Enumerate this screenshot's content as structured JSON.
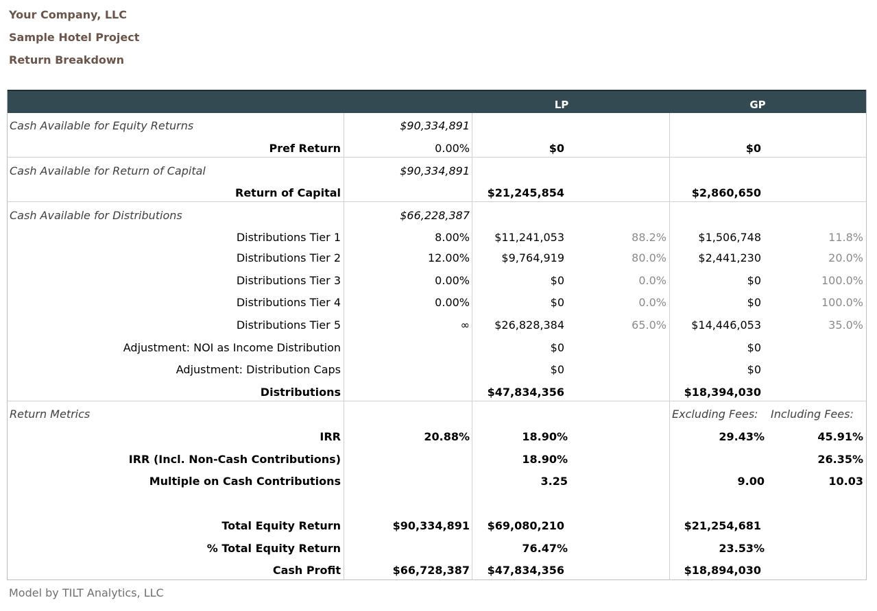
{
  "header": {
    "company": "Your Company, LLC",
    "project": "Sample Hotel Project",
    "title": "Return Breakdown"
  },
  "columns": {
    "lp": "LP",
    "gp": "GP"
  },
  "sections": {
    "equity": {
      "label": "Cash Available for Equity Returns",
      "amount": "$90,334,891",
      "pref": {
        "label": "Pref Return",
        "pct": "0.00%",
        "lp": "$0",
        "gp": "$0"
      }
    },
    "capital": {
      "label": "Cash Available for Return of Capital",
      "amount": "$90,334,891",
      "roc": {
        "label": "Return of Capital",
        "lp": "$21,245,854",
        "gp": "$2,860,650"
      }
    },
    "distributions": {
      "label": "Cash Available for Distributions",
      "amount": "$66,228,387",
      "tiers": [
        {
          "label": "Distributions Tier 1",
          "pct": "8.00%",
          "lp": "$11,241,053",
          "lp_share": "88.2%",
          "gp": "$1,506,748",
          "gp_share": "11.8%"
        },
        {
          "label": "Distributions Tier 2",
          "pct": "12.00%",
          "lp": "$9,764,919",
          "lp_share": "80.0%",
          "gp": "$2,441,230",
          "gp_share": "20.0%"
        },
        {
          "label": "Distributions Tier 3",
          "pct": "0.00%",
          "lp": "$0",
          "lp_share": "0.0%",
          "gp": "$0",
          "gp_share": "100.0%"
        },
        {
          "label": "Distributions Tier 4",
          "pct": "0.00%",
          "lp": "$0",
          "lp_share": "0.0%",
          "gp": "$0",
          "gp_share": "100.0%"
        },
        {
          "label": "Distributions Tier 5",
          "pct": "∞",
          "lp": "$26,828,384",
          "lp_share": "65.0%",
          "gp": "$14,446,053",
          "gp_share": "35.0%"
        }
      ],
      "adj_noi": {
        "label": "Adjustment: NOI as Income Distribution",
        "lp": "$0",
        "gp": "$0"
      },
      "adj_caps": {
        "label": "Adjustment: Distribution Caps",
        "lp": "$0",
        "gp": "$0"
      },
      "total": {
        "label": "Distributions",
        "lp": "$47,834,356",
        "gp": "$18,394,030"
      }
    },
    "metrics": {
      "label": "Return Metrics",
      "excluding": "Excluding Fees:",
      "including": "Including Fees:",
      "irr": {
        "label": "IRR",
        "total": "20.88%",
        "lp": "18.90%",
        "gp_ex": "29.43%",
        "gp_in": "45.91%"
      },
      "irr_noncash": {
        "label": "IRR (Incl. Non-Cash Contributions)",
        "lp": "18.90%",
        "gp_in": "26.35%"
      },
      "multiple": {
        "label": "Multiple on Cash Contributions",
        "lp": "3.25",
        "gp_ex": "9.00",
        "gp_in": "10.03"
      },
      "total_equity": {
        "label": "Total Equity Return",
        "total": "$90,334,891",
        "lp": "$69,080,210",
        "gp": "$21,254,681"
      },
      "pct_equity": {
        "label": "% Total Equity Return",
        "lp": "76.47%",
        "gp": "23.53%"
      },
      "cash_profit": {
        "label": "Cash Profit",
        "total": "$66,728,387",
        "lp": "$47,834,356",
        "gp": "$18,894,030"
      }
    }
  },
  "footer": "Model by TILT Analytics, LLC"
}
